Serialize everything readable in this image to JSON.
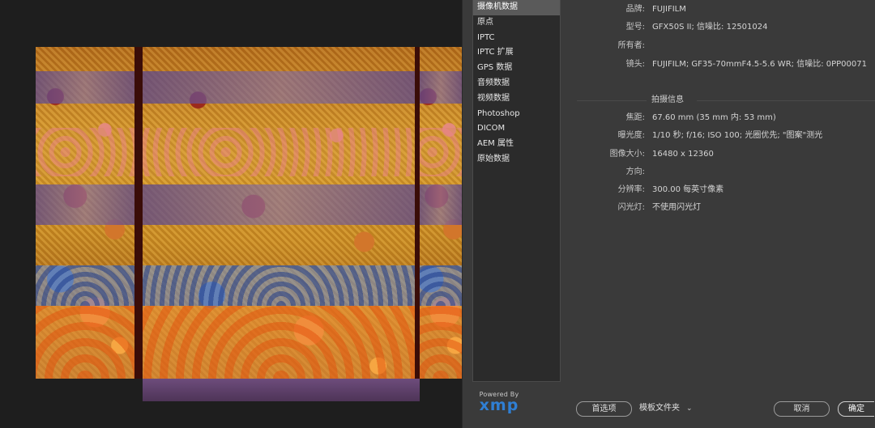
{
  "categories": [
    {
      "label": "摄像机数据",
      "selected": true
    },
    {
      "label": "原点"
    },
    {
      "label": "IPTC"
    },
    {
      "label": "IPTC 扩展"
    },
    {
      "label": "GPS 数据"
    },
    {
      "label": "音频数据"
    },
    {
      "label": "视频数据"
    },
    {
      "label": "Photoshop"
    },
    {
      "label": "DICOM"
    },
    {
      "label": "AEM 属性"
    },
    {
      "label": "原始数据"
    }
  ],
  "camera": {
    "make_label": "品牌:",
    "make_value": "FUJIFILM",
    "model_label": "型号:",
    "model_value": "GFX50S II;  信噪比: 12501024",
    "owner_label": "所有者:",
    "owner_value": "",
    "lens_label": "镜头:",
    "lens_value": "FUJIFILM;  GF35-70mmF4.5-5.6 WR;  信噪比: 0PP00071"
  },
  "shooting": {
    "section_title": "拍摄信息",
    "focal_label": "焦距:",
    "focal_value": "67.60 mm    (35 mm 内: 53 mm)",
    "exposure_label": "曝光度:",
    "exposure_value": "1/10 秒;  f/16;  ISO 100;  光圈优先;  \"图案\"测光",
    "size_label": "图像大小:",
    "size_value": "16480 x 12360",
    "orientation_label": "方向:",
    "orientation_value": "",
    "resolution_label": "分辨率:",
    "resolution_value": "300.00 每英寸像素",
    "flash_label": "闪光灯:",
    "flash_value": "不使用闪光灯"
  },
  "logo": {
    "powered": "Powered By",
    "word": "xmp"
  },
  "buttons": {
    "preferences": "首选项",
    "template": "模板文件夹",
    "cancel": "取消",
    "ok": "确定"
  },
  "colors": {
    "accent": "#2f7fd4",
    "dialog_bg": "#3a3a3a",
    "list_bg": "#2b2b2b"
  }
}
